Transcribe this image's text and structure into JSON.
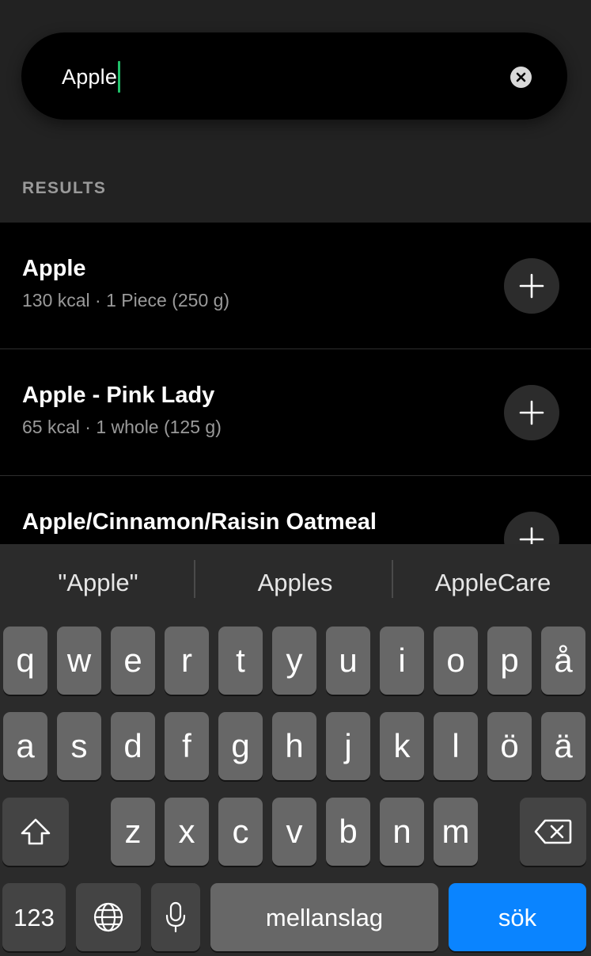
{
  "search": {
    "query": "Apple"
  },
  "section_label": "RESULTS",
  "results": [
    {
      "title": "Apple",
      "meta": "130 kcal · 1 Piece (250 g)"
    },
    {
      "title": "Apple - Pink Lady",
      "meta": "65 kcal · 1 whole (125 g)"
    },
    {
      "title": "Apple/Cinnamon/Raisin Oatmeal",
      "meta": ""
    }
  ],
  "keyboard": {
    "suggestions": [
      "\"Apple\"",
      "Apples",
      "AppleCare"
    ],
    "row1": [
      "q",
      "w",
      "e",
      "r",
      "t",
      "y",
      "u",
      "i",
      "o",
      "p",
      "å"
    ],
    "row2": [
      "a",
      "s",
      "d",
      "f",
      "g",
      "h",
      "j",
      "k",
      "l",
      "ö",
      "ä"
    ],
    "row3": [
      "z",
      "x",
      "c",
      "v",
      "b",
      "n",
      "m"
    ],
    "numbers_label": "123",
    "space_label": "mellanslag",
    "search_label": "sök"
  },
  "colors": {
    "background": "#222222",
    "caret": "#21c06a",
    "search_key": "#0a84ff"
  }
}
